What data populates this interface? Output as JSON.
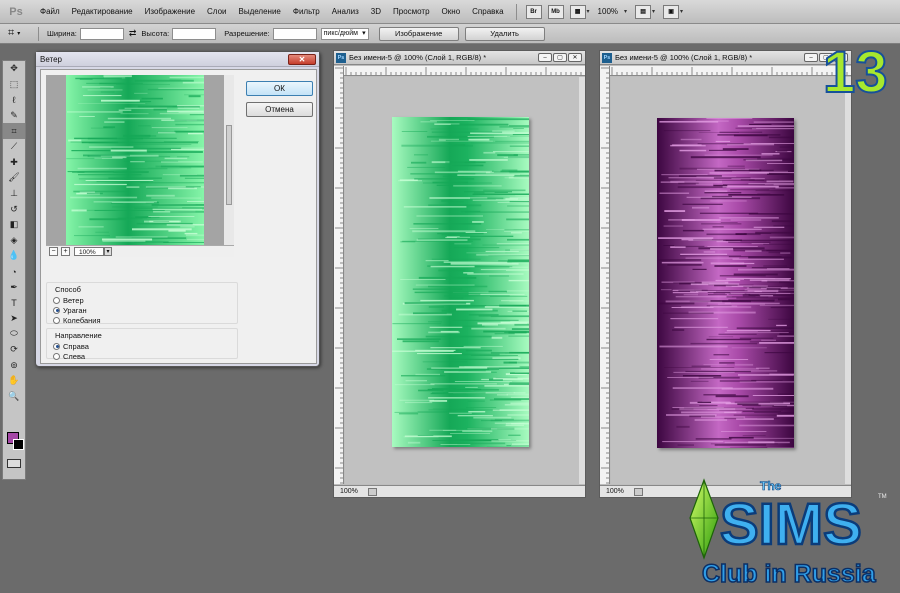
{
  "app": {
    "logo_text": "Ps"
  },
  "menubar": {
    "items": [
      "Файл",
      "Редактирование",
      "Изображение",
      "Слои",
      "Выделение",
      "Фильтр",
      "Анализ",
      "3D",
      "Просмотр",
      "Окно",
      "Справка"
    ],
    "bridge_label": "Br",
    "minibridge_label": "Mb",
    "zoom": "100%"
  },
  "options": {
    "width_label": "Ширина:",
    "height_label": "Высота:",
    "resolution_label": "Разрешение:",
    "units": "пикс/дюйм",
    "image_button": "Изображение",
    "delete_button": "Удалить"
  },
  "dialog": {
    "title": "Ветер",
    "ok": "ОК",
    "cancel": "Отмена",
    "zoom": "100%",
    "zoom_minus": "−",
    "zoom_plus": "+",
    "method": {
      "title": "Способ",
      "options": [
        "Ветер",
        "Ураган",
        "Колебания"
      ],
      "selected": "Ураган"
    },
    "direction": {
      "title": "Направление",
      "options": [
        "Справа",
        "Слева"
      ],
      "selected": "Справа"
    }
  },
  "documents": [
    {
      "title": "Без имени-5 @ 100% (Слой 1, RGB/8) *",
      "zoom": "100%",
      "palette": "green"
    },
    {
      "title": "Без имени-5 @ 100% (Слой 1, RGB/8) *",
      "zoom": "100%",
      "palette": "purple"
    }
  ],
  "colors": {
    "foreground": "#a547a6",
    "background": "#000000",
    "green_light": "#a8fbc0",
    "green_dark": "#15a857",
    "purple_light": "#c468c4",
    "purple_dark": "#3c0640"
  },
  "watermark": {
    "number": "13",
    "logo_the": "The",
    "logo_sims": "SIMS",
    "logo_tagline": "Club in Russia",
    "logo_tm": "TM"
  }
}
